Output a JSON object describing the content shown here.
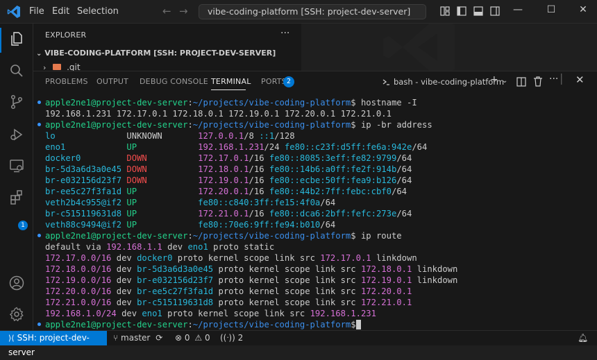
{
  "titlebar": {
    "menu": [
      "File",
      "Edit",
      "Selection"
    ],
    "command_center": "vibe-coding-platform [SSH: project-dev-server]"
  },
  "sidebar": {
    "title": "EXPLORER",
    "more": "···",
    "folder": "VIBE-CODING-PLATFORM [SSH: PROJECT-DEV-SERVER]",
    "first_item": ".git"
  },
  "activity": {
    "extensions_badge": "1"
  },
  "panel": {
    "tabs": [
      "PROBLEMS",
      "OUTPUT",
      "DEBUG CONSOLE",
      "TERMINAL",
      "PORTS"
    ],
    "active_tab": "TERMINAL",
    "ports_badge": "2",
    "terminal_name": "bash - vibe-coding-platform"
  },
  "terminal": {
    "user": "apple2ne1@project-dev-server",
    "path": "~/projects/vibe-coding-platform",
    "lines": [
      {
        "prompt": true,
        "cmd": " hostname -I"
      },
      {
        "plain": "192.168.1.231 172.17.0.1 172.18.0.1 172.19.0.1 172.20.0.1 172.21.0.1 "
      },
      {
        "prompt": true,
        "cmd": " ip -br address"
      },
      {
        "addr": [
          "lo",
          "UNKNOWN",
          "127.0.0.1",
          "/8 ",
          "::1",
          "/128"
        ]
      },
      {
        "addr": [
          "eno1",
          "UP",
          "192.168.1.231",
          "/24 ",
          "fe80::c23f:d5ff:fe6a:942e",
          "/64"
        ]
      },
      {
        "addr": [
          "docker0",
          "DOWN",
          "172.17.0.1",
          "/16 ",
          "fe80::8085:3eff:fe82:9799",
          "/64"
        ]
      },
      {
        "addr": [
          "br-5d3a6d3a0e45",
          "DOWN",
          "172.18.0.1",
          "/16 ",
          "fe80::14b6:a0ff:fe2f:914b",
          "/64"
        ]
      },
      {
        "addr": [
          "br-e032156d23f7",
          "DOWN",
          "172.19.0.1",
          "/16 ",
          "fe80::ecbe:50ff:fea9:b126",
          "/64"
        ]
      },
      {
        "addr": [
          "br-ee5c27f3fa1d",
          "UP",
          "172.20.0.1",
          "/16 ",
          "fe80::44b2:7ff:febc:cbf0",
          "/64"
        ]
      },
      {
        "addr": [
          "veth2b4c955@if2",
          "UP",
          "",
          "",
          "fe80::c840:3ff:fe15:4f0a",
          "/64"
        ]
      },
      {
        "addr": [
          "br-c515119631d8",
          "UP",
          "172.21.0.1",
          "/16 ",
          "fe80::dca6:2bff:fefc:273e",
          "/64"
        ]
      },
      {
        "addr": [
          "veth88c9494@if2",
          "UP",
          "",
          "",
          "fe80::70e6:9ff:fe94:b010",
          "/64"
        ]
      },
      {
        "prompt": true,
        "cmd": " ip route"
      },
      {
        "route": [
          "default via ",
          "192.168.1.1",
          " dev ",
          "eno1",
          " proto static",
          "",
          ""
        ]
      },
      {
        "route": [
          "172.17.0.0/16",
          " dev ",
          "docker0",
          " proto kernel scope link src ",
          "172.17.0.1",
          " linkdown",
          ""
        ]
      },
      {
        "route": [
          "172.18.0.0/16",
          " dev ",
          "br-5d3a6d3a0e45",
          " proto kernel scope link src ",
          "172.18.0.1",
          " linkdown",
          ""
        ]
      },
      {
        "route": [
          "172.19.0.0/16",
          " dev ",
          "br-e032156d23f7",
          " proto kernel scope link src ",
          "172.19.0.1",
          " linkdown",
          ""
        ]
      },
      {
        "route": [
          "172.20.0.0/16",
          " dev ",
          "br-ee5c27f3fa1d",
          " proto kernel scope link src ",
          "172.20.0.1",
          "",
          ""
        ]
      },
      {
        "route": [
          "172.21.0.0/16",
          " dev ",
          "br-c515119631d8",
          " proto kernel scope link src ",
          "172.21.0.1",
          "",
          ""
        ]
      },
      {
        "route": [
          "192.168.1.0/24",
          " dev ",
          "eno1",
          " proto kernel scope link src ",
          "192.168.1.231",
          "",
          ""
        ]
      },
      {
        "prompt": true,
        "cmd": "",
        "cursor": true
      }
    ]
  },
  "statusbar": {
    "remote": "SSH: project-dev-server",
    "branch": "master",
    "errors": "0",
    "warnings": "0",
    "ports": "2"
  },
  "colors": {
    "accent": "#0078d4",
    "prompt_user": "#23d18b",
    "prompt_path": "#3b8eea",
    "state_down": "#f14c4c",
    "ipv4": "#d670d6",
    "ipv6": "#29b8db"
  }
}
